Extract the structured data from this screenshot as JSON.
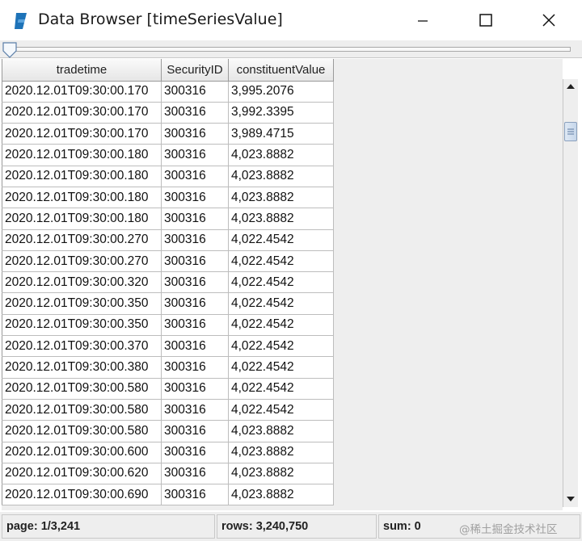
{
  "window": {
    "title": "Data Browser [timeSeriesValue]",
    "accent": "#1e73b8"
  },
  "table": {
    "columns": [
      "tradetime",
      "SecurityID",
      "constituentValue"
    ],
    "rows": [
      [
        "2020.12.01T09:30:00.170",
        "300316",
        "3,995.2076"
      ],
      [
        "2020.12.01T09:30:00.170",
        "300316",
        "3,992.3395"
      ],
      [
        "2020.12.01T09:30:00.170",
        "300316",
        "3,989.4715"
      ],
      [
        "2020.12.01T09:30:00.180",
        "300316",
        "4,023.8882"
      ],
      [
        "2020.12.01T09:30:00.180",
        "300316",
        "4,023.8882"
      ],
      [
        "2020.12.01T09:30:00.180",
        "300316",
        "4,023.8882"
      ],
      [
        "2020.12.01T09:30:00.180",
        "300316",
        "4,023.8882"
      ],
      [
        "2020.12.01T09:30:00.270",
        "300316",
        "4,022.4542"
      ],
      [
        "2020.12.01T09:30:00.270",
        "300316",
        "4,022.4542"
      ],
      [
        "2020.12.01T09:30:00.320",
        "300316",
        "4,022.4542"
      ],
      [
        "2020.12.01T09:30:00.350",
        "300316",
        "4,022.4542"
      ],
      [
        "2020.12.01T09:30:00.350",
        "300316",
        "4,022.4542"
      ],
      [
        "2020.12.01T09:30:00.370",
        "300316",
        "4,022.4542"
      ],
      [
        "2020.12.01T09:30:00.380",
        "300316",
        "4,022.4542"
      ],
      [
        "2020.12.01T09:30:00.580",
        "300316",
        "4,022.4542"
      ],
      [
        "2020.12.01T09:30:00.580",
        "300316",
        "4,022.4542"
      ],
      [
        "2020.12.01T09:30:00.580",
        "300316",
        "4,023.8882"
      ],
      [
        "2020.12.01T09:30:00.600",
        "300316",
        "4,023.8882"
      ],
      [
        "2020.12.01T09:30:00.620",
        "300316",
        "4,023.8882"
      ],
      [
        "2020.12.01T09:30:00.690",
        "300316",
        "4,023.8882"
      ]
    ]
  },
  "status": {
    "page": "page: 1/3,241",
    "rows": "rows: 3,240,750",
    "sum": "sum: 0"
  },
  "watermark": "@稀土掘金技术社区"
}
